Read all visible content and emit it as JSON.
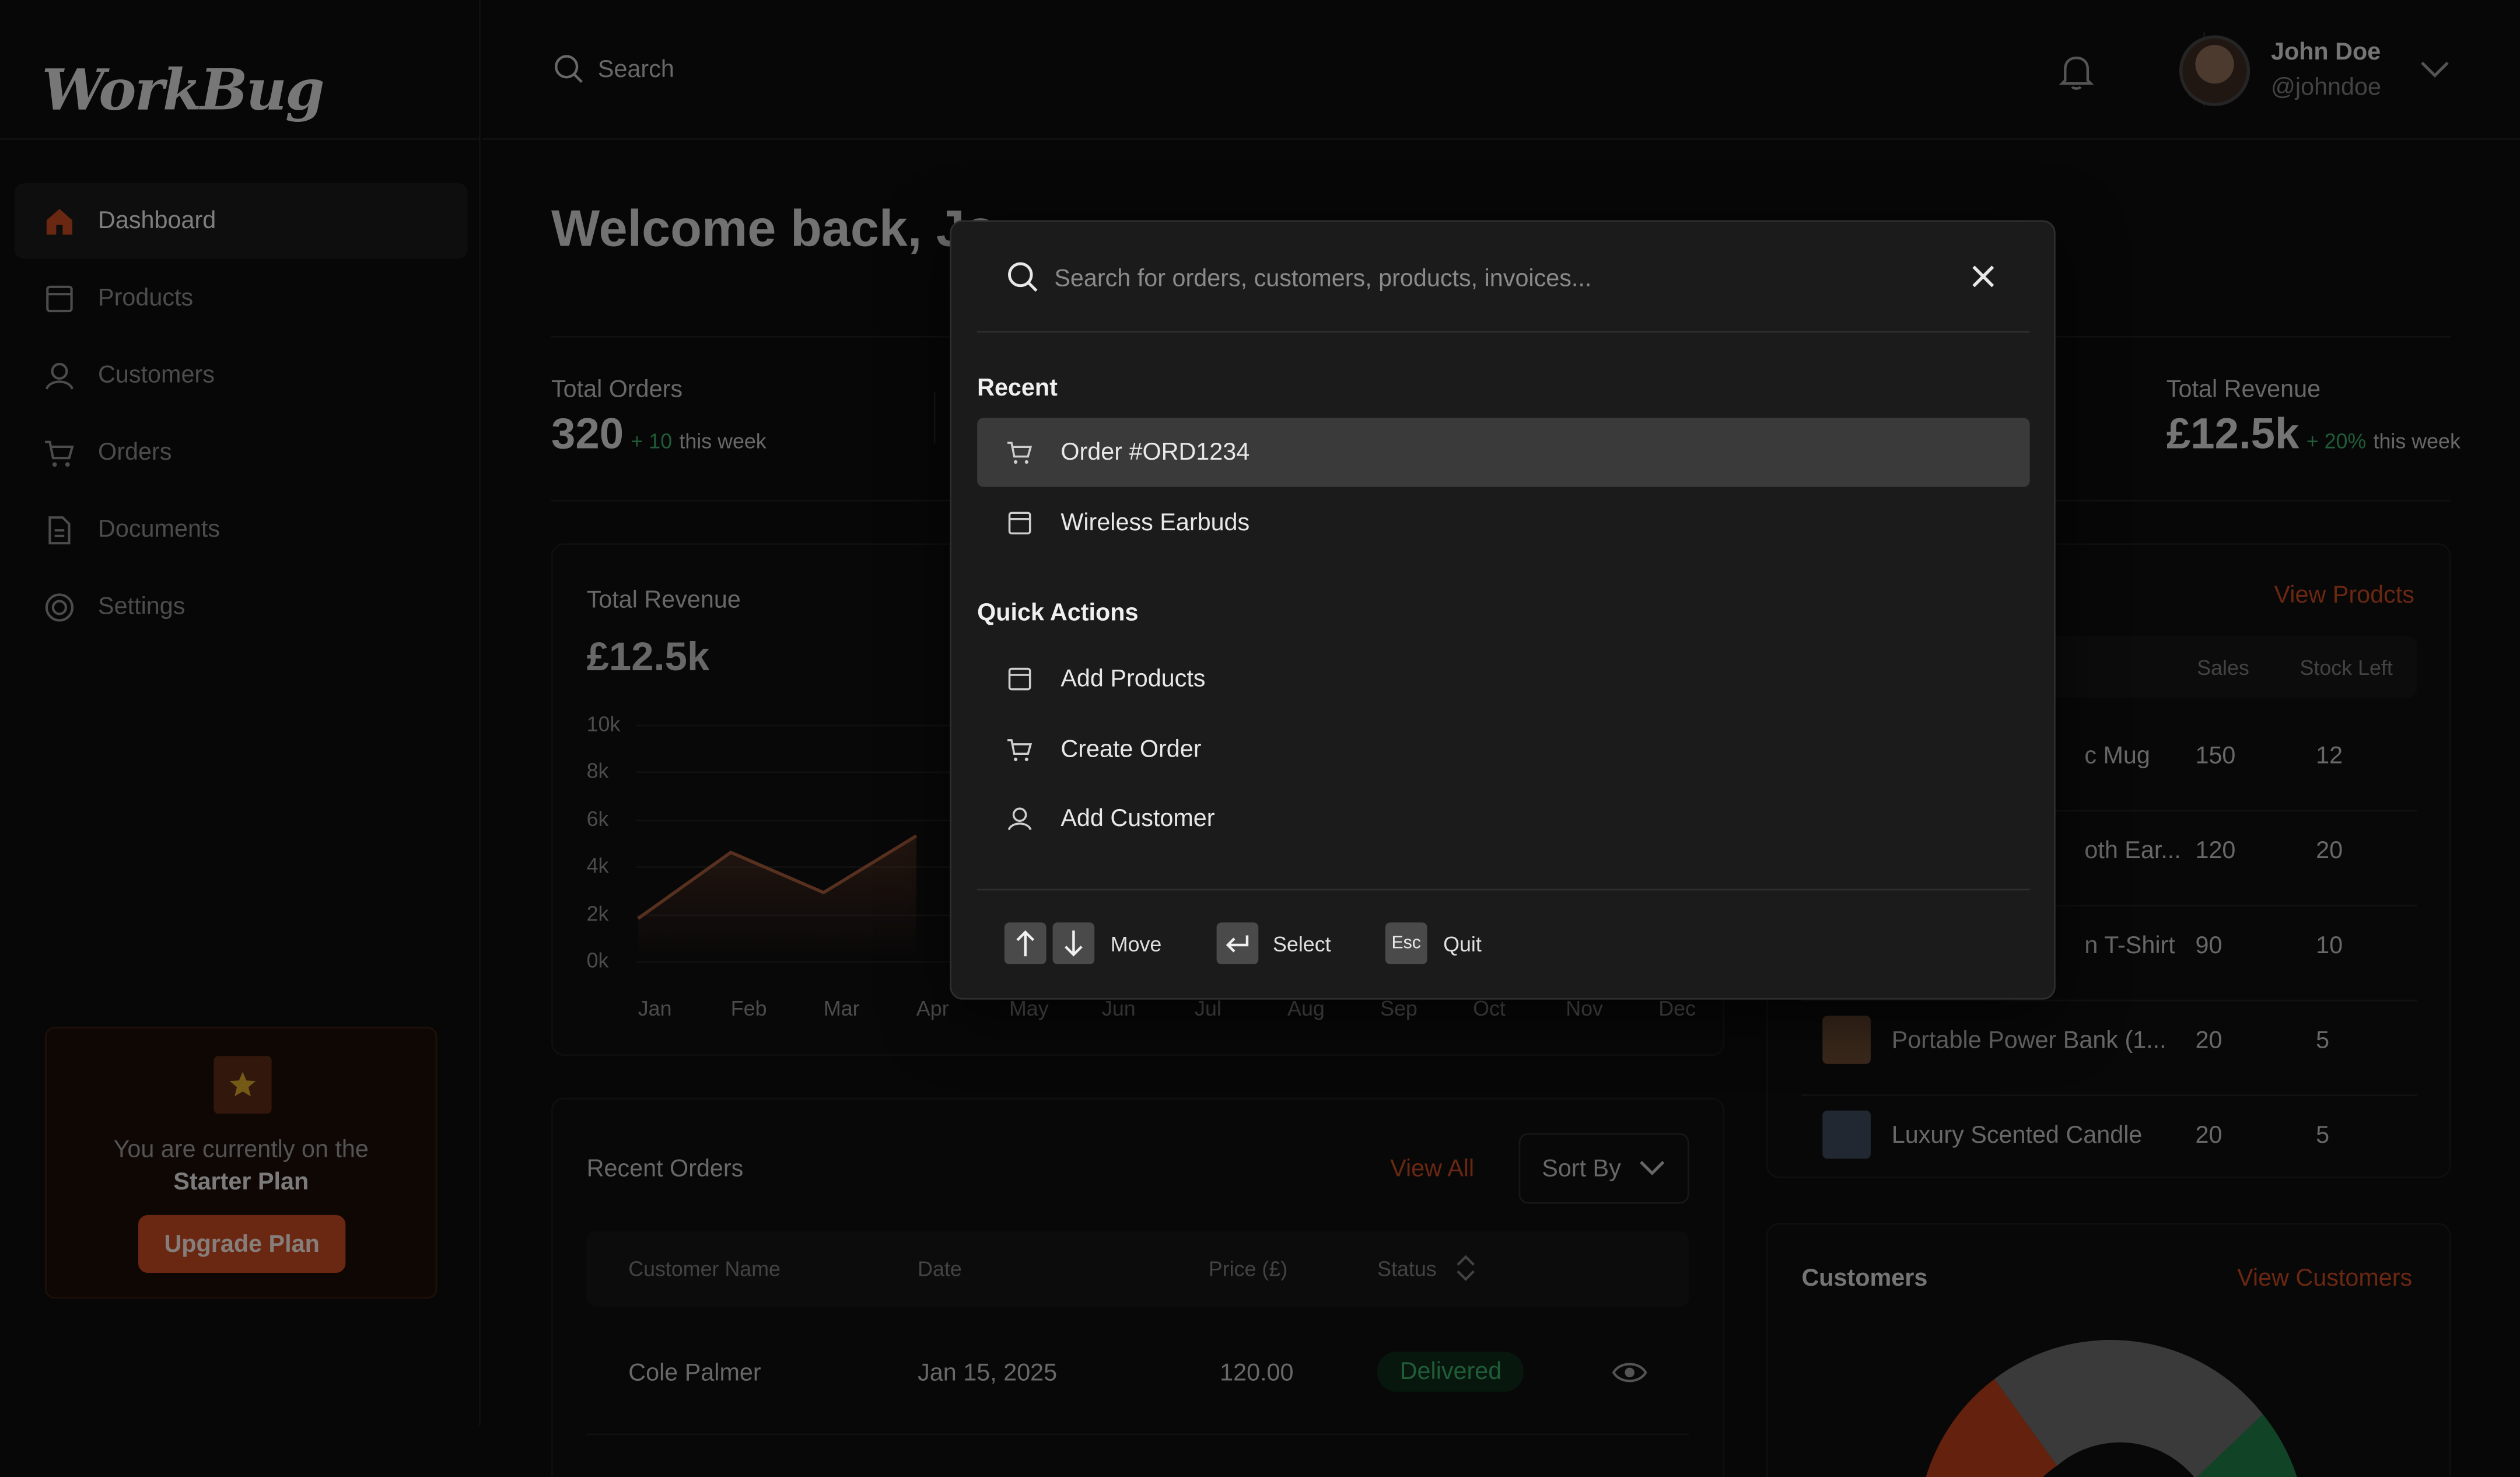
{
  "app": {
    "logo": "WorkBug"
  },
  "sidebar": {
    "items": [
      {
        "label": "Dashboard",
        "icon": "home-icon",
        "active": true
      },
      {
        "label": "Products",
        "icon": "box-icon"
      },
      {
        "label": "Customers",
        "icon": "user-icon"
      },
      {
        "label": "Orders",
        "icon": "cart-icon"
      },
      {
        "label": "Documents",
        "icon": "document-icon"
      },
      {
        "label": "Settings",
        "icon": "gear-icon"
      }
    ],
    "plan": {
      "text": "You are currently on the",
      "plan_name": "Starter Plan",
      "button": "Upgrade Plan"
    }
  },
  "topbar": {
    "search_label": "Search",
    "user": {
      "name": "John Doe",
      "handle": "@johndoe"
    }
  },
  "main": {
    "welcome": "Welcome back,  Jo",
    "stats": [
      {
        "label": "Total Orders",
        "value": "320",
        "delta": "+ 10",
        "sub": "this week"
      },
      {
        "label": "Total Revenue",
        "value": "£12.5k",
        "delta": "+ 20%",
        "sub": "this week"
      }
    ],
    "revenue_chart": {
      "title": "Total Revenue",
      "value": "£12.5k"
    },
    "recent_orders": {
      "title": "Recent Orders",
      "view_all": "View All",
      "sort_label": "Sort  By",
      "columns": [
        "Customer Name",
        "Date",
        "Price (£)",
        "Status"
      ],
      "rows": [
        {
          "customer": "Cole Palmer",
          "date": "Jan 15, 2025",
          "price": "120.00",
          "status": "Delivered"
        }
      ]
    },
    "products": {
      "view_link": "View Prodcts",
      "columns": [
        "Sales",
        "Stock Left"
      ],
      "rows": [
        {
          "name": "c Mug",
          "sales": "150",
          "stock": "12"
        },
        {
          "name": "oth Ear...",
          "sales": "120",
          "stock": "20"
        },
        {
          "name": "n T-Shirt",
          "sales": "90",
          "stock": "10"
        },
        {
          "name": "Portable Power Bank (1...",
          "sales": "20",
          "stock": "5"
        },
        {
          "name": "Luxury Scented Candle",
          "sales": "20",
          "stock": "5"
        }
      ]
    },
    "customers": {
      "title": "Customers",
      "view_link": "View Customers"
    }
  },
  "chart_data": {
    "type": "area",
    "title": "Total Revenue",
    "categories": [
      "Jan",
      "Feb",
      "Mar",
      "Apr",
      "May",
      "Jun",
      "Jul",
      "Aug",
      "Sep",
      "Oct",
      "Nov",
      "Dec"
    ],
    "yticks": [
      "10k",
      "8k",
      "6k",
      "4k",
      "2k",
      "0k"
    ],
    "ylim": [
      0,
      10000
    ],
    "series": [
      {
        "values": [
          1800,
          4600,
          2900,
          5300
        ]
      }
    ],
    "grid": true,
    "color": "#a0583a"
  },
  "palette": {
    "placeholder": "Search for orders, customers, products, invoices...",
    "recent_label": "Recent",
    "recent": [
      {
        "label": "Order #ORD1234",
        "icon": "cart-icon",
        "selected": true
      },
      {
        "label": "Wireless Earbuds",
        "icon": "box-icon"
      }
    ],
    "quick_label": "Quick Actions",
    "quick": [
      {
        "label": "Add Products",
        "icon": "box-icon"
      },
      {
        "label": "Create Order",
        "icon": "cart-icon"
      },
      {
        "label": "Add Customer",
        "icon": "user-icon"
      }
    ],
    "hints": {
      "move": "Move",
      "select": "Select",
      "esc_key": "Esc",
      "quit": "Quit"
    }
  },
  "colors": {
    "accent": "#c2481f",
    "success": "#3aa864",
    "background": "#0e0e0e",
    "panel": "#1b1b1b"
  }
}
